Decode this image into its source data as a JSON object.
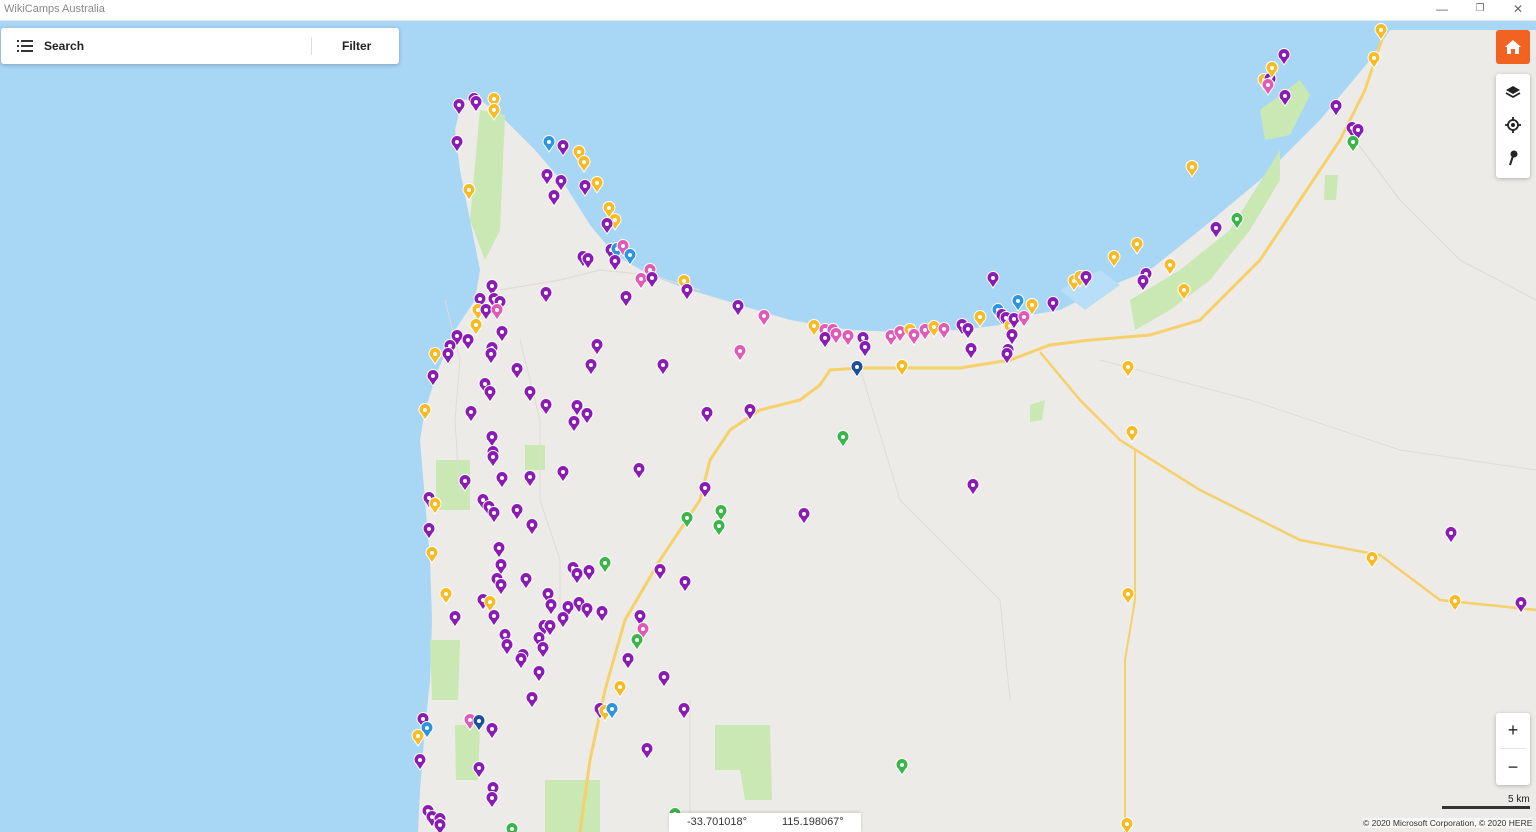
{
  "window": {
    "title": "WikiCamps Australia",
    "minimize_glyph": "—",
    "restore_glyph": "❐",
    "close_glyph": "✕"
  },
  "search": {
    "menu_icon": "list-icon",
    "label": "Search",
    "filter_label": "Filter"
  },
  "controls": {
    "home_icon": "home-icon",
    "layers_icon": "layers-icon",
    "locate_icon": "locate-icon",
    "pin_icon": "pin-icon",
    "zoom_in": "+",
    "zoom_out": "−"
  },
  "map": {
    "scale_label": "5 km",
    "copyright": "© 2020 Microsoft Corporation, © 2020 HERE",
    "latitude": "-33.701018°",
    "longitude": "115.198067°"
  },
  "colors": {
    "water": "#a8d6f5",
    "land": "#ecebe7",
    "park": "#c9e8b4",
    "road": "#f6d06a",
    "accent_orange": "#f26322",
    "marker_purple": "#8a1cb5",
    "marker_yellow": "#f7bb25",
    "marker_pink": "#e05ab8",
    "marker_green": "#3ab54a",
    "marker_blue": "#2b95e0",
    "marker_navy": "#1d4fa0"
  }
}
